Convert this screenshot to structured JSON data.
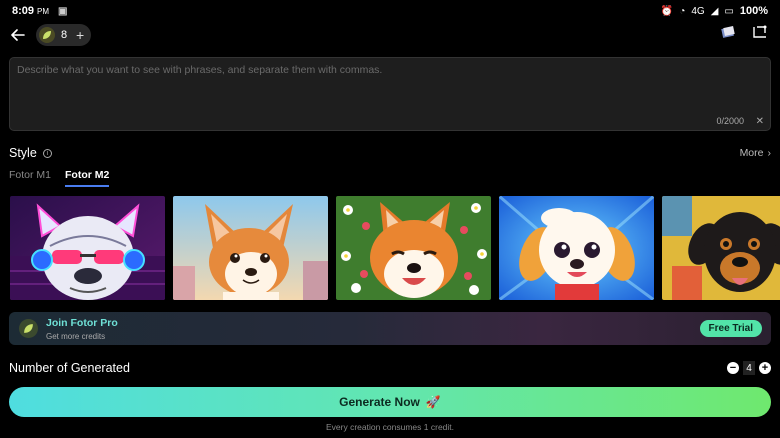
{
  "status_bar": {
    "time": "8:09",
    "ampm": "PM",
    "network": "4G",
    "battery": "100%"
  },
  "header": {
    "credits": "8"
  },
  "prompt": {
    "placeholder": "Describe what you want to see with phrases, and separate them with commas.",
    "value": "",
    "counter": "0/2000"
  },
  "style": {
    "title": "Style",
    "more_label": "More",
    "tabs": [
      {
        "label": "Fotor M1",
        "active": false
      },
      {
        "label": "Fotor M2",
        "active": true
      }
    ],
    "thumbnails": [
      "neon-bulldog-with-headphones",
      "cartoon-corgi",
      "shiba-inu-with-flowers",
      "cartoon-puppy",
      "painted-rottweiler"
    ]
  },
  "promo": {
    "title": "Join Fotor Pro",
    "subtitle": "Get more credits",
    "button": "Free Trial"
  },
  "generated": {
    "label": "Number of Generated",
    "value": "4"
  },
  "generate": {
    "label": "Generate Now",
    "note": "Every creation consumes 1 credit."
  },
  "colors": {
    "accent_tab": "#4a7df0",
    "promo_title": "#6fe0d6",
    "trial_button": "#52e3a8",
    "generate_gradient_start": "#4fdde0",
    "generate_gradient_end": "#6fe86e"
  }
}
